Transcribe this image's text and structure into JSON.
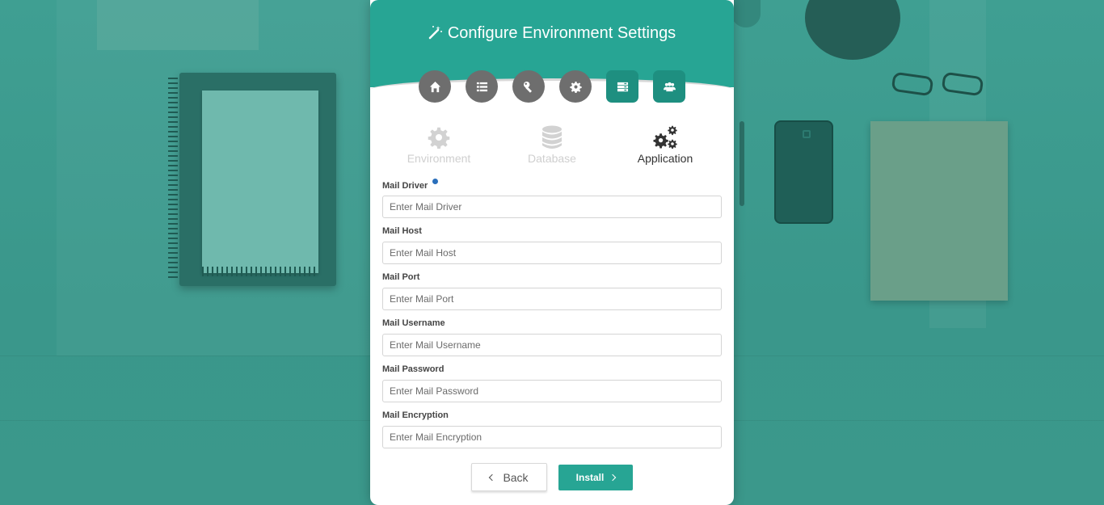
{
  "header": {
    "title": "Configure Environment Settings",
    "icon": "magic-wand-icon",
    "color": "#27a594"
  },
  "steps": [
    {
      "name": "home",
      "icon": "home-icon",
      "state": "done"
    },
    {
      "name": "requirements",
      "icon": "list-icon",
      "state": "done"
    },
    {
      "name": "permissions",
      "icon": "key-icon",
      "state": "done"
    },
    {
      "name": "settings",
      "icon": "gear-icon",
      "state": "done"
    },
    {
      "name": "environment",
      "icon": "server-icon",
      "state": "active"
    },
    {
      "name": "users",
      "icon": "users-icon",
      "state": "active"
    }
  ],
  "tabs": [
    {
      "label": "Environment",
      "icon": "gear-icon",
      "state": "inactive"
    },
    {
      "label": "Database",
      "icon": "database-icon",
      "state": "inactive"
    },
    {
      "label": "Application",
      "icon": "gears-icon",
      "state": "current"
    }
  ],
  "form": {
    "fields": [
      {
        "label": "Mail Driver",
        "placeholder": "Enter Mail Driver",
        "value": "",
        "has_info": true
      },
      {
        "label": "Mail Host",
        "placeholder": "Enter Mail Host",
        "value": ""
      },
      {
        "label": "Mail Port",
        "placeholder": "Enter Mail Port",
        "value": ""
      },
      {
        "label": "Mail Username",
        "placeholder": "Enter Mail Username",
        "value": ""
      },
      {
        "label": "Mail Password",
        "placeholder": "Enter Mail Password",
        "value": ""
      },
      {
        "label": "Mail Encryption",
        "placeholder": "Enter Mail Encryption",
        "value": ""
      }
    ]
  },
  "buttons": {
    "back_label": "Back",
    "install_label": "Install"
  }
}
